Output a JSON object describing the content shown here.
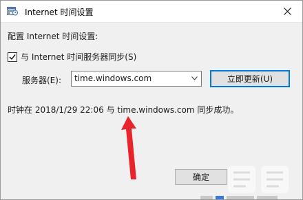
{
  "window": {
    "title": "Internet 时间设置",
    "title_icon": "calendar-clock-icon"
  },
  "dialog": {
    "heading": "配置 Internet 时间设置:",
    "sync_checkbox": {
      "label": "与 Internet 时间服务器同步(S)",
      "checked": true
    },
    "server": {
      "label": "服务器(E):",
      "value": "time.windows.com"
    },
    "update_button": "立即更新(U)",
    "status": "时钟在 2018/1/29 22:06 与 time.windows.com 同步成功。",
    "ok_button": "确定"
  },
  "colors": {
    "accent": "#0078d7",
    "annotation_arrow": "#e8232b",
    "dialog_bg": "#f0f0f0"
  }
}
